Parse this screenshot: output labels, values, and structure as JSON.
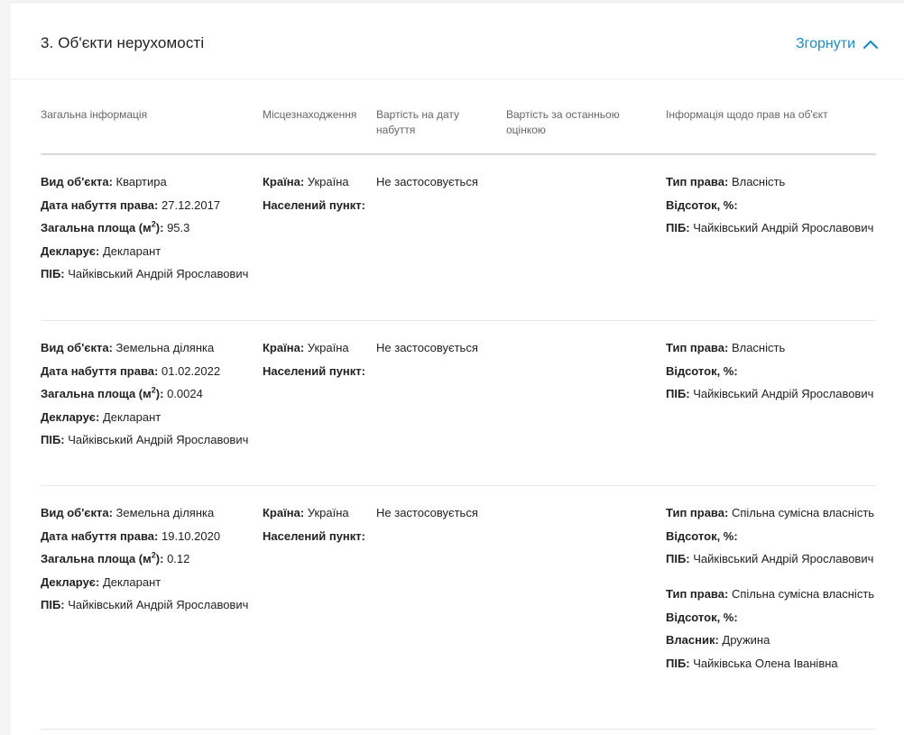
{
  "section": {
    "title": "3. Об'єкти нерухомості",
    "collapse_label": "Згорнути"
  },
  "columns": {
    "general": "Загальна інформація",
    "location": "Місцезнаходження",
    "cost_acquisition": "Вартість на дату набуття",
    "cost_last": "Вартість за останньою оцінкою",
    "rights": "Інформація щодо прав на об'єкт"
  },
  "labels": {
    "object_type": "Вид об'єкта:",
    "acquisition_date": "Дата набуття права:",
    "area_prefix": "Загальна площа (м",
    "area_sup": "2",
    "area_suffix": "):",
    "declares": "Декларує:",
    "pib": "ПІБ:",
    "country": "Країна:",
    "settlement": "Населений пункт:",
    "right_type": "Тип права:",
    "percent": "Відсоток, %:",
    "owner": "Власник:"
  },
  "rows": [
    {
      "object_type": "Квартира",
      "acquisition_date": "27.12.2017",
      "area": "95.3",
      "declares": "Декларант",
      "pib": "Чайківський Андрій Ярославович",
      "country": "Україна",
      "cost_acquisition": "Не застосовується",
      "rights": [
        {
          "type": "Власність",
          "pib": "Чайківський Андрій Ярославович"
        }
      ]
    },
    {
      "object_type": "Земельна ділянка",
      "acquisition_date": "01.02.2022",
      "area": "0.0024",
      "declares": "Декларант",
      "pib": "Чайківський Андрій Ярославович",
      "country": "Україна",
      "cost_acquisition": "Не застосовується",
      "rights": [
        {
          "type": "Власність",
          "pib": "Чайківський Андрій Ярославович"
        }
      ]
    },
    {
      "object_type": "Земельна ділянка",
      "acquisition_date": "19.10.2020",
      "area": "0.12",
      "declares": "Декларант",
      "pib": "Чайківський Андрій Ярославович",
      "country": "Україна",
      "cost_acquisition": "Не застосовується",
      "rights": [
        {
          "type": "Спільна сумісна власність",
          "pib": "Чайківський Андрій Ярославович"
        },
        {
          "type": "Спільна сумісна власність",
          "owner": "Дружина",
          "pib": "Чайківська Олена Іванівна"
        }
      ]
    }
  ],
  "colors": {
    "accent": "#1e8bc3"
  }
}
